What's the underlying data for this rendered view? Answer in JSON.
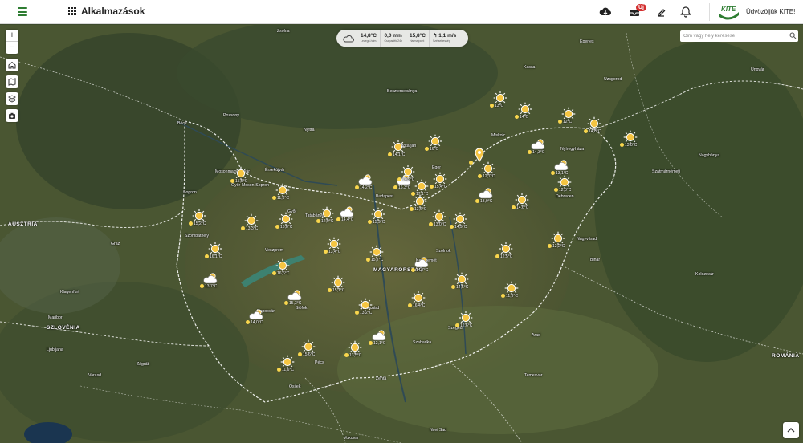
{
  "topbar": {
    "apps_label": "Alkalmazások",
    "badge": "Új",
    "welcome": "Üdvözöljük KITE!",
    "logo_text": "KITE"
  },
  "weather": {
    "temp": "14,8°C",
    "temp_label": "Levegő-hőm.",
    "precip": "0,0 mm",
    "precip_label": "Csapadék 24h",
    "dew": "15,8°C",
    "dew_label": "Harmatpont",
    "wind": "1,1 m/s",
    "wind_label": "Szélsebesség"
  },
  "search": {
    "placeholder": "Cím vagy hely keresése"
  },
  "map": {
    "countries": [
      "AUSZTRIA",
      "SZLOVÉNIA",
      "ROMÁNIA",
      "MAGYARORSZÁG"
    ],
    "cities": [
      "Bécs",
      "Pozsony",
      "Budapest",
      "Debrecen",
      "Szeged",
      "Graz",
      "Miskolc",
      "Győr",
      "Pécs",
      "Kecskemét",
      "Nagyvárad",
      "Kolozsvár",
      "Nyíregyháza",
      "Szabadka",
      "Zágráb",
      "Eger",
      "Szolnok",
      "Siófok",
      "Kassa",
      "Uzsgorod",
      "Temesvár",
      "Arad",
      "Novi Sad",
      "Ljubljana",
      "Salgótarján",
      "Szombathely",
      "Veszprém",
      "Tatabánya",
      "Szekszárd",
      "Kaposvár",
      "Sopron",
      "Szatmárnémeti",
      "Nagybánya",
      "Zsolna",
      "Besztercebánya",
      "Nyitra",
      "Eperjes",
      "Varasd",
      "Maribor",
      "Klagenfurt",
      "Osijek",
      "Vukovar",
      "Zenta",
      "Bihar",
      "Érsekújvár",
      "Mosonmagyaróvár",
      "Győr-Moson-Sopron",
      "Ungvár"
    ],
    "stations": [
      "13°C",
      "14°C",
      "12°C",
      "14,8°C",
      "13,8°C",
      "14,1°C",
      "16°C",
      "15°C",
      "12,7°C",
      "15,5°C",
      "14,3°C",
      "13,1°C",
      "12,8°C",
      "14,2°C",
      "16,3°C",
      "17,1°C",
      "15,4°C",
      "13,9°C",
      "14,6°C",
      "11,8°C",
      "15,2°C",
      "13,3°C",
      "16,8°C",
      "12,9°C",
      "14,4°C",
      "15,9°C",
      "13,6°C",
      "14,9°C",
      "12,2°C",
      "16,1°C",
      "13,4°C",
      "15,7°C",
      "14,7°C",
      "12,5°C",
      "16,6°C",
      "13,7°C",
      "15,1°C",
      "14,5°C",
      "11,9°C",
      "15,3°C",
      "13,2°C",
      "16,4°C",
      "12,6°C",
      "14,0°C",
      "15,6°C",
      "13,5°C",
      "12,1°C",
      "11,6°C",
      "14,2°C",
      "13,0°C"
    ]
  }
}
